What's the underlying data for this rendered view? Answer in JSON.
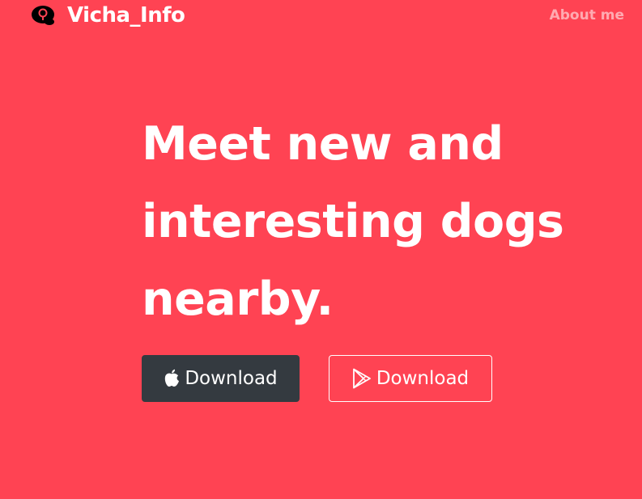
{
  "header": {
    "brand_name": "Vicha_Info",
    "brand_icon": "brain-icon",
    "nav_about": "About me"
  },
  "hero": {
    "heading_lines": [
      "Meet new and",
      "interesting dogs",
      "nearby."
    ]
  },
  "buttons": {
    "apple": {
      "label": "Download",
      "icon": "apple-icon"
    },
    "play": {
      "label": "Download",
      "icon": "google-play-icon"
    }
  },
  "colors": {
    "background": "#ff4353",
    "dark_button": "#343a40",
    "text": "#ffffff"
  }
}
